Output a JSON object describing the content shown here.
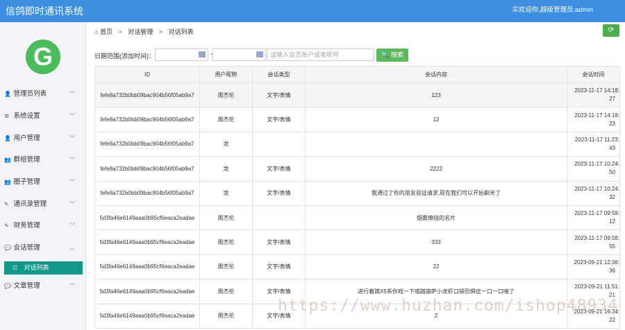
{
  "app": {
    "title": "信鸽即时通讯系统",
    "welcome": "㊣欢迎你,超级管理员:admin"
  },
  "sidebar": {
    "avatar_letter": "G",
    "items": [
      {
        "label": "管理员列表",
        "icon": "user-icon",
        "glyph": "👤"
      },
      {
        "label": "系统设置",
        "icon": "gear-icon",
        "glyph": "⚙"
      },
      {
        "label": "用户管理",
        "icon": "user-icon",
        "glyph": "👤"
      },
      {
        "label": "群组管理",
        "icon": "users-icon",
        "glyph": "👥"
      },
      {
        "label": "圈子管理",
        "icon": "users-icon",
        "glyph": "👥"
      },
      {
        "label": "通讯录管理",
        "icon": "edit-icon",
        "glyph": "✎"
      },
      {
        "label": "财务管理",
        "icon": "edit-icon",
        "glyph": "✎"
      },
      {
        "label": "会话管理",
        "icon": "comment-icon",
        "glyph": "💬"
      },
      {
        "label": "文章管理",
        "icon": "comment-icon",
        "glyph": "💬"
      }
    ],
    "submenu": {
      "label": "对话列表",
      "icon": "list-icon"
    }
  },
  "breadcrumb": {
    "home": "首页",
    "level1": "对话管理",
    "level2": "对话列表"
  },
  "filter": {
    "label": "日期范围(添加时间)：",
    "dash": "-",
    "keyword_placeholder": "请输入会员账户或者昵称",
    "search_label": "搜索"
  },
  "table": {
    "columns": [
      "ID",
      "用户昵称",
      "会话类型",
      "会话内容",
      "会话时间"
    ],
    "rows": [
      {
        "id": "fefe8a732b0bb09bac904b56f05ab9a7",
        "nick": "周杰伦",
        "type": "文字/表情",
        "content": "123",
        "time": "2023-11-17 14:18:",
        "sec": "27"
      },
      {
        "id": "fefe8a732b0bb09bac904b56f05ab9a7",
        "nick": "周杰伦",
        "type": "文字/表情",
        "content": "12",
        "time": "2023-11-17 14:18:",
        "sec": "23"
      },
      {
        "id": "fefe8a732b0bb09bac904b56f05ab9a7",
        "nick": "龙",
        "type": "",
        "content": "",
        "time": "2023-11-17 11:23:",
        "sec": "43"
      },
      {
        "id": "fefe8a732b0bb09bac904b56f05ab9a7",
        "nick": "龙",
        "type": "文字/表情",
        "content": "2222",
        "time": "2023-11-17 10:24:",
        "sec": "50"
      },
      {
        "id": "fefe8a732b0bb09bac904b56f05ab9a7",
        "nick": "龙",
        "type": "文字/表情",
        "content": "我通过了你的朋友验证请求,现在我们可以开始聊天了",
        "time": "2023-11-17 10:24:",
        "sec": "32"
      },
      {
        "id": "5d3fa46e6149aaa0b95cf6eaca2eadae",
        "nick": "周杰伦",
        "type": "",
        "content": "烟雾缭绕的名片",
        "time": "2023-11-17 09:59:",
        "sec": "12"
      },
      {
        "id": "5d3fa46e6149aaa0b95cf6eaca2eadae",
        "nick": "周杰伦",
        "type": "文字/表情",
        "content": "333",
        "time": "2023-11-17 09:58:",
        "sec": "55"
      },
      {
        "id": "5d3fa46e6149aaa0b95cf6eaca2eadae",
        "nick": "周杰伦",
        "type": "文字/表情",
        "content": "22",
        "time": "2023-09-21 12:36:",
        "sec": "36"
      },
      {
        "id": "5d3fa46e6149aaa0b95cf6eaca2eadae",
        "nick": "周杰伦",
        "type": "文字/表情",
        "content": "进行着踏X5系你戏一下嗒踏崩萨小龙虾口袋恐惧症一口一口喘了",
        "time": "2023-09-21 11:51:",
        "sec": "21"
      },
      {
        "id": "5d3fa46e6149aaa0b95cf6eaca2eadae",
        "nick": "周杰伦",
        "type": "文字/表情",
        "content": "2",
        "time": "2023-09-21 16:34:",
        "sec": "22"
      }
    ]
  },
  "watermark": "https://www.huzhan.com/ishop48934"
}
